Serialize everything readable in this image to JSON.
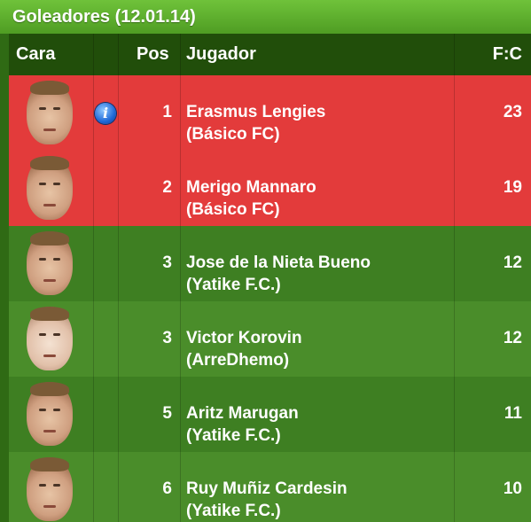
{
  "title": "Goleadores (12.01.14)",
  "headers": {
    "cara": "Cara",
    "pos": "Pos",
    "jugador": "Jugador",
    "fc": "F:C"
  },
  "colors": {
    "highlight": "#e33b3b",
    "row_even": "#3e7f22",
    "row_odd": "#4a8d2a",
    "header": "#214e0a",
    "title": "#5aa82a"
  },
  "rows": [
    {
      "pos": "1",
      "name": "Erasmus Lengies",
      "club": "(Básico FC)",
      "fc": "23",
      "highlight": true,
      "info": true,
      "face": "player-face"
    },
    {
      "pos": "2",
      "name": "Merigo Mannaro",
      "club": "(Básico FC)",
      "fc": "19",
      "highlight": true,
      "info": false,
      "face": "player-face"
    },
    {
      "pos": "3",
      "name": "Jose de la Nieta Bueno",
      "club": "(Yatike F.C.)",
      "fc": "12",
      "highlight": false,
      "info": false,
      "face": "player-face"
    },
    {
      "pos": "3",
      "name": "Victor Korovin",
      "club": "(ArreDhemo)",
      "fc": "12",
      "highlight": false,
      "info": false,
      "face": "player-face"
    },
    {
      "pos": "5",
      "name": "Aritz Marugan",
      "club": "(Yatike F.C.)",
      "fc": "11",
      "highlight": false,
      "info": false,
      "face": "player-face"
    },
    {
      "pos": "6",
      "name": "Ruy Muñiz Cardesin",
      "club": "(Yatike F.C.)",
      "fc": "10",
      "highlight": false,
      "info": false,
      "face": "player-face"
    }
  ]
}
